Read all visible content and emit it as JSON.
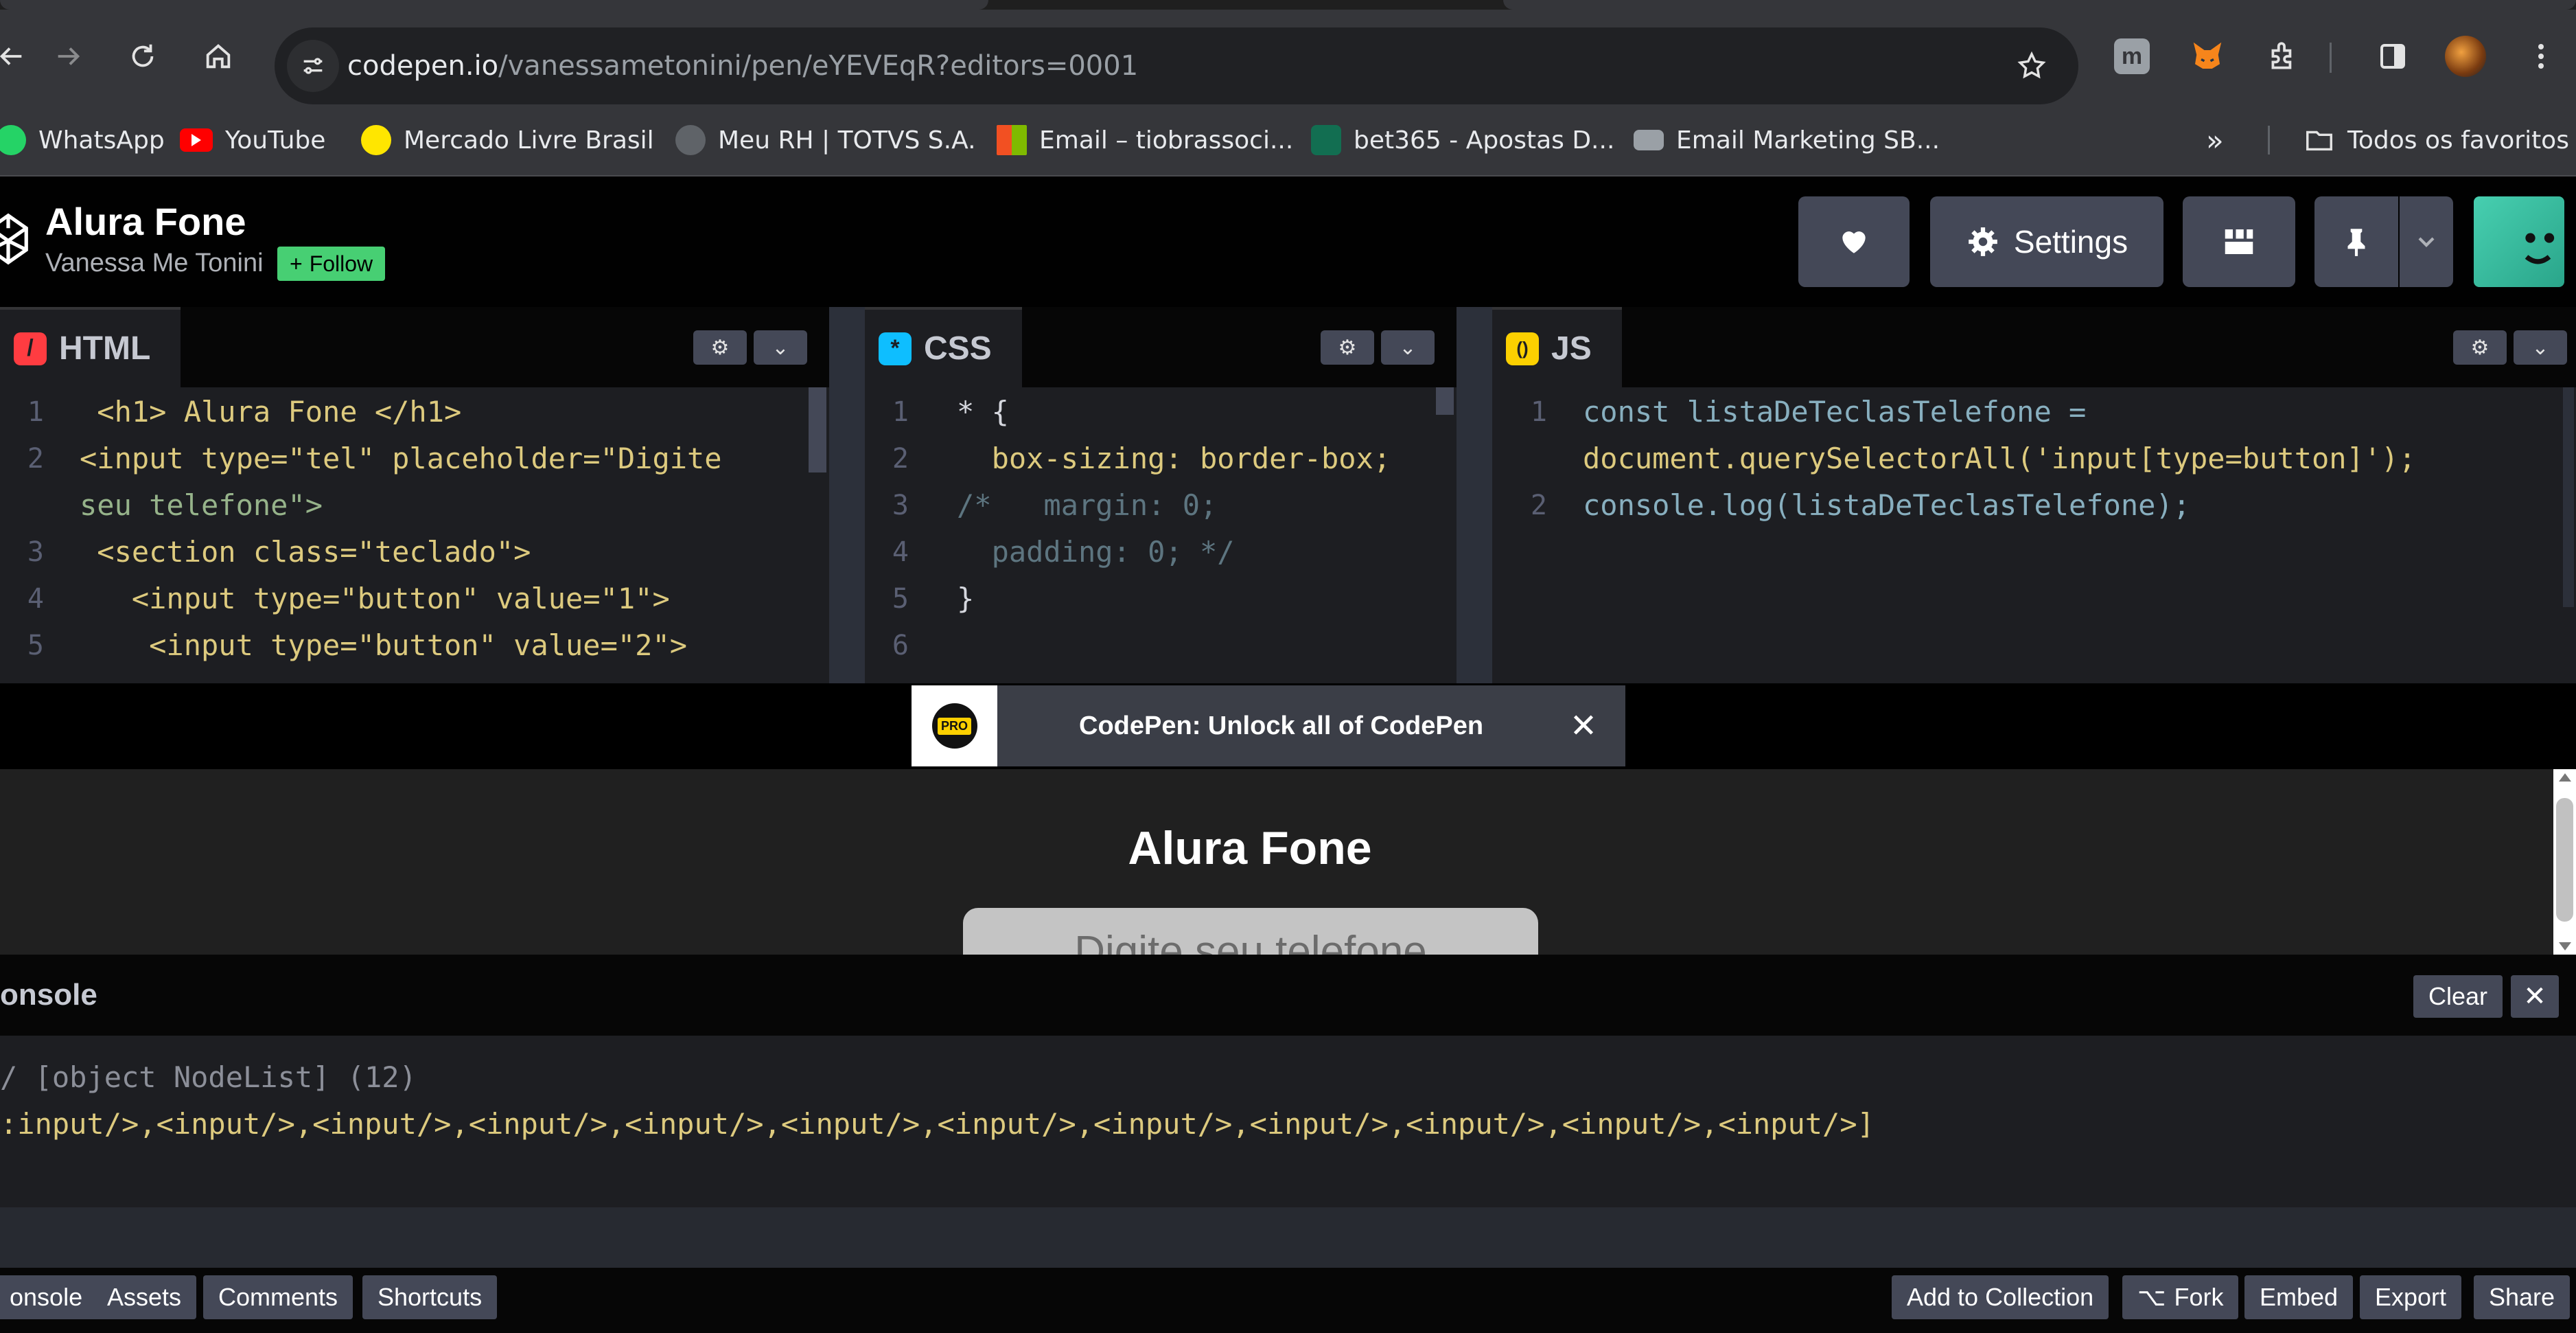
{
  "browser": {
    "url_domain": "codepen.io",
    "url_path": "/vanessametonini/pen/eYEVEqR?editors=0001",
    "bookmarks": [
      {
        "label": "WhatsApp",
        "color": "#25d366"
      },
      {
        "label": "YouTube",
        "color": "#ff0000"
      },
      {
        "label": "Mercado Livre Brasil",
        "color": "#ffe600"
      },
      {
        "label": "Meu RH | TOTVS S.A.",
        "color": "#5f6368"
      },
      {
        "label": "Email – tiobrassoci...",
        "color": "#f25022"
      },
      {
        "label": "bet365 - Apostas D...",
        "color": "#126e51"
      },
      {
        "label": "Email Marketing SB...",
        "color": "#9aa0a6"
      }
    ],
    "all_bookmarks_label": "Todos os favoritos",
    "icons": [
      "back-icon",
      "forward-icon",
      "reload-icon",
      "home-icon",
      "site-info-icon",
      "star-icon",
      "extensions-icon",
      "side-panel-icon",
      "profile-avatar",
      "menu-icon"
    ]
  },
  "header": {
    "title": "Alura Fone",
    "author": "Vanessa Me Tonini",
    "follow_label": "Follow",
    "settings_label": "Settings"
  },
  "editors": {
    "html": {
      "label": "HTML",
      "icon": "/",
      "color": "#ff3c41",
      "lines": [
        {
          "n": "1",
          "text": " <h1> Alura Fone </h1>"
        },
        {
          "n": "2",
          "text": "<input type=\"tel\" placeholder=\"Digite"
        },
        {
          "n": "",
          "text": "seu telefone\">"
        },
        {
          "n": "3",
          "text": " <section class=\"teclado\">"
        },
        {
          "n": "4",
          "text": "   <input type=\"button\" value=\"1\">"
        },
        {
          "n": "5",
          "text": "    <input type=\"button\" value=\"2\">"
        }
      ]
    },
    "css": {
      "label": "CSS",
      "icon": "*",
      "color": "#0ebeff",
      "lines": [
        {
          "n": "1",
          "text": "* {"
        },
        {
          "n": "2",
          "text": "  box-sizing: border-box;"
        },
        {
          "n": "3",
          "text": "/*   margin: 0;"
        },
        {
          "n": "4",
          "text": "  padding: 0; */"
        },
        {
          "n": "5",
          "text": "}"
        },
        {
          "n": "6",
          "text": ""
        }
      ]
    },
    "js": {
      "label": "JS",
      "icon": "()",
      "color": "#fcd000",
      "lines": [
        {
          "n": "1",
          "text": "const listaDeTeclasTelefone ="
        },
        {
          "n": "",
          "text": "document.querySelectorAll('input[type=button]');"
        },
        {
          "n": "2",
          "text": "console.log(listaDeTeclasTelefone);"
        }
      ]
    }
  },
  "promo": {
    "badge": "PRO",
    "text": "CodePen: Unlock all of CodePen"
  },
  "preview": {
    "heading": "Alura Fone",
    "input_placeholder": "Digite seu telefone"
  },
  "console": {
    "title": "onsole",
    "clear_label": "Clear",
    "line1": "/ [object NodeList] (12)",
    "line2": ":input/>,<input/>,<input/>,<input/>,<input/>,<input/>,<input/>,<input/>,<input/>,<input/>,<input/>,<input/>]"
  },
  "footer": {
    "left": [
      "onsole",
      "Assets",
      "Comments",
      "Shortcuts"
    ],
    "right": [
      "Add to Collection",
      "Fork",
      "Embed",
      "Export",
      "Share"
    ]
  }
}
